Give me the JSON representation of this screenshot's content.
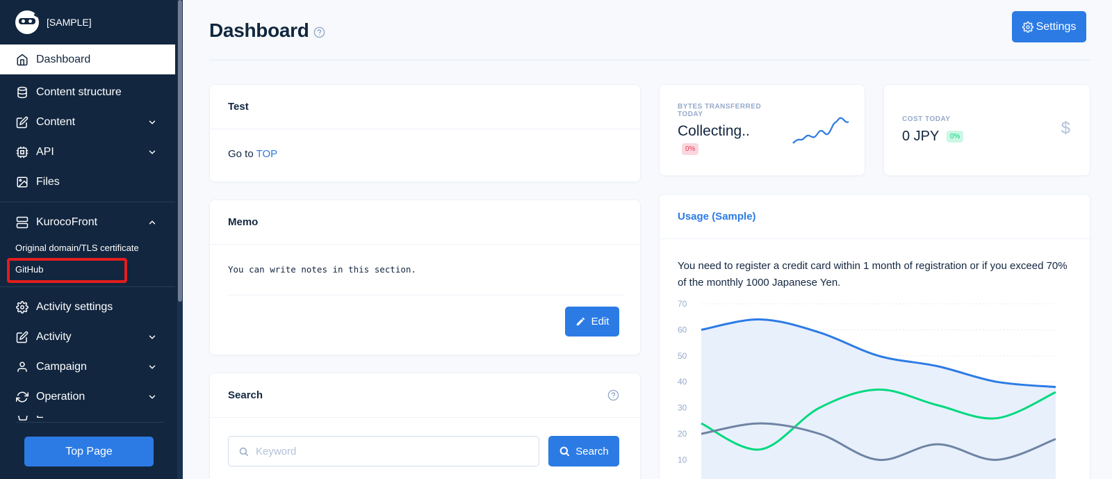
{
  "brand": {
    "name": "[SAMPLE]"
  },
  "sidebar": {
    "items": [
      {
        "label": "Dashboard",
        "icon": "home-icon"
      },
      {
        "label": "Content structure",
        "icon": "database-icon"
      },
      {
        "label": "Content",
        "icon": "edit-icon"
      },
      {
        "label": "API",
        "icon": "cpu-icon"
      },
      {
        "label": "Files",
        "icon": "image-icon"
      },
      {
        "label": "KurocoFront",
        "icon": "server-icon"
      },
      {
        "label": "Activity settings",
        "icon": "gear-icon"
      },
      {
        "label": "Activity",
        "icon": "edit-icon"
      },
      {
        "label": "Campaign",
        "icon": "user-icon"
      },
      {
        "label": "Operation",
        "icon": "refresh-icon"
      },
      {
        "label": "E",
        "icon": "cart-icon"
      }
    ],
    "sub_items": [
      "Original domain/TLS certificate",
      "GitHub"
    ],
    "top_page_button": "Top Page"
  },
  "header": {
    "title": "Dashboard",
    "settings_label": "Settings"
  },
  "test_card": {
    "title": "Test",
    "text": "Go to ",
    "link": "TOP"
  },
  "memo_card": {
    "title": "Memo",
    "text": "You can write notes in this section.",
    "edit_label": "Edit"
  },
  "search_card": {
    "title": "Search",
    "placeholder": "Keyword",
    "button_label": "Search"
  },
  "bytes_card": {
    "label": "BYTES TRANSFERRED TODAY",
    "value": "Collecting..",
    "badge": "0%"
  },
  "cost_card": {
    "label": "COST TODAY",
    "value": "0 JPY",
    "badge": "0%",
    "icon": "dollar-icon"
  },
  "usage_card": {
    "title": "Usage (Sample)",
    "text": "You need to register a credit card within 1 month of registration or if you exceed 70% of the monthly 1000 Japanese Yen."
  },
  "colors": {
    "primary": "#2c7be5",
    "sidebar_bg": "#12263f",
    "success": "#00d97e",
    "danger": "#e63757",
    "gray_series": "#6e84a3",
    "highlight_box": "#e21d1d"
  },
  "chart_data": {
    "type": "area",
    "title": "",
    "xlabel": "",
    "ylabel": "",
    "ylim": [
      0,
      70
    ],
    "y_ticks": [
      10,
      20,
      30,
      40,
      50,
      60,
      70
    ],
    "x": [
      0,
      1,
      2,
      3,
      4,
      5,
      6
    ],
    "grid": true,
    "series": [
      {
        "name": "",
        "color": "#2c7be5",
        "fill": true,
        "values": [
          60,
          64,
          59,
          50,
          46,
          40,
          38
        ]
      },
      {
        "name": "",
        "color": "#00d97e",
        "fill": false,
        "values": [
          24,
          14,
          30,
          37,
          31,
          26,
          36
        ]
      },
      {
        "name": "",
        "color": "#6e84a3",
        "fill": false,
        "values": [
          20,
          24,
          20,
          10,
          16,
          10,
          18
        ]
      }
    ]
  }
}
